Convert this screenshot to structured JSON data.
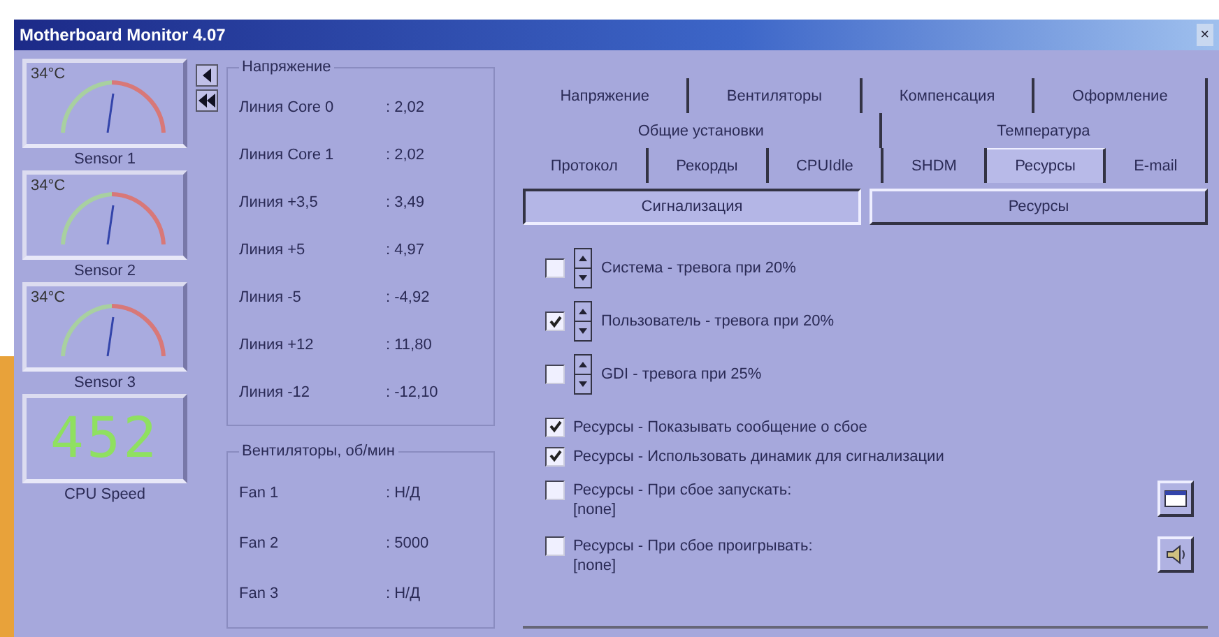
{
  "window": {
    "title": "Motherboard Monitor 4.07",
    "close": "×"
  },
  "sensors": [
    {
      "temp": "34°C",
      "label": "Sensor 1"
    },
    {
      "temp": "34°C",
      "label": "Sensor 2"
    },
    {
      "temp": "34°C",
      "label": "Sensor 3"
    }
  ],
  "cpu_speed": {
    "value": "452",
    "label": "CPU Speed"
  },
  "voltages": {
    "title": "Напряжение",
    "rows": [
      {
        "name": "Линия Core 0",
        "value": ": 2,02"
      },
      {
        "name": "Линия Core 1",
        "value": ": 2,02"
      },
      {
        "name": "Линия +3,5",
        "value": ": 3,49"
      },
      {
        "name": "Линия +5",
        "value": ": 4,97"
      },
      {
        "name": "Линия -5",
        "value": ": -4,92"
      },
      {
        "name": "Линия +12",
        "value": ": 11,80"
      },
      {
        "name": "Линия -12",
        "value": ": -12,10"
      }
    ]
  },
  "fans": {
    "title": "Вентиляторы, об/мин",
    "rows": [
      {
        "name": "Fan 1",
        "value": ": Н/Д"
      },
      {
        "name": "Fan 2",
        "value": ": 5000"
      },
      {
        "name": "Fan 3",
        "value": ": Н/Д"
      }
    ]
  },
  "tab_rows": [
    [
      {
        "label": "Напряжение",
        "selected": false
      },
      {
        "label": "Вентиляторы",
        "selected": false
      },
      {
        "label": "Компенсация",
        "selected": false
      },
      {
        "label": "Оформление",
        "selected": false
      }
    ],
    [
      {
        "label": "Общие установки",
        "selected": false
      },
      {
        "label": "Температура",
        "selected": false
      }
    ],
    [
      {
        "label": "Протокол",
        "selected": false
      },
      {
        "label": "Рекорды",
        "selected": false
      },
      {
        "label": "CPUIdle",
        "selected": false
      },
      {
        "label": "SHDM",
        "selected": false
      },
      {
        "label": "Ресурсы",
        "selected": true
      },
      {
        "label": "E-mail",
        "selected": false
      }
    ]
  ],
  "subtabs": [
    {
      "label": "Сигнализация",
      "selected": true
    },
    {
      "label": "Ресурсы",
      "selected": false
    }
  ],
  "options": [
    {
      "kind": "spin",
      "label": "Система - тревога при 20%",
      "checked": false
    },
    {
      "kind": "spin",
      "label": "Пользователь - тревога при 20%",
      "checked": true
    },
    {
      "kind": "spin",
      "label": "GDI - тревога при 25%",
      "checked": false
    },
    {
      "kind": "check",
      "label": "Ресурсы - Показывать сообщение о сбое",
      "checked": true
    },
    {
      "kind": "check",
      "label": "Ресурсы - Использовать динамик для сигнализации",
      "checked": true
    },
    {
      "kind": "program",
      "label": "Ресурсы - При сбое запускать:",
      "note": "[none]",
      "checked": false
    },
    {
      "kind": "sound",
      "label": "Ресурсы - При сбое проигрывать:",
      "note": "[none]",
      "checked": false
    }
  ]
}
